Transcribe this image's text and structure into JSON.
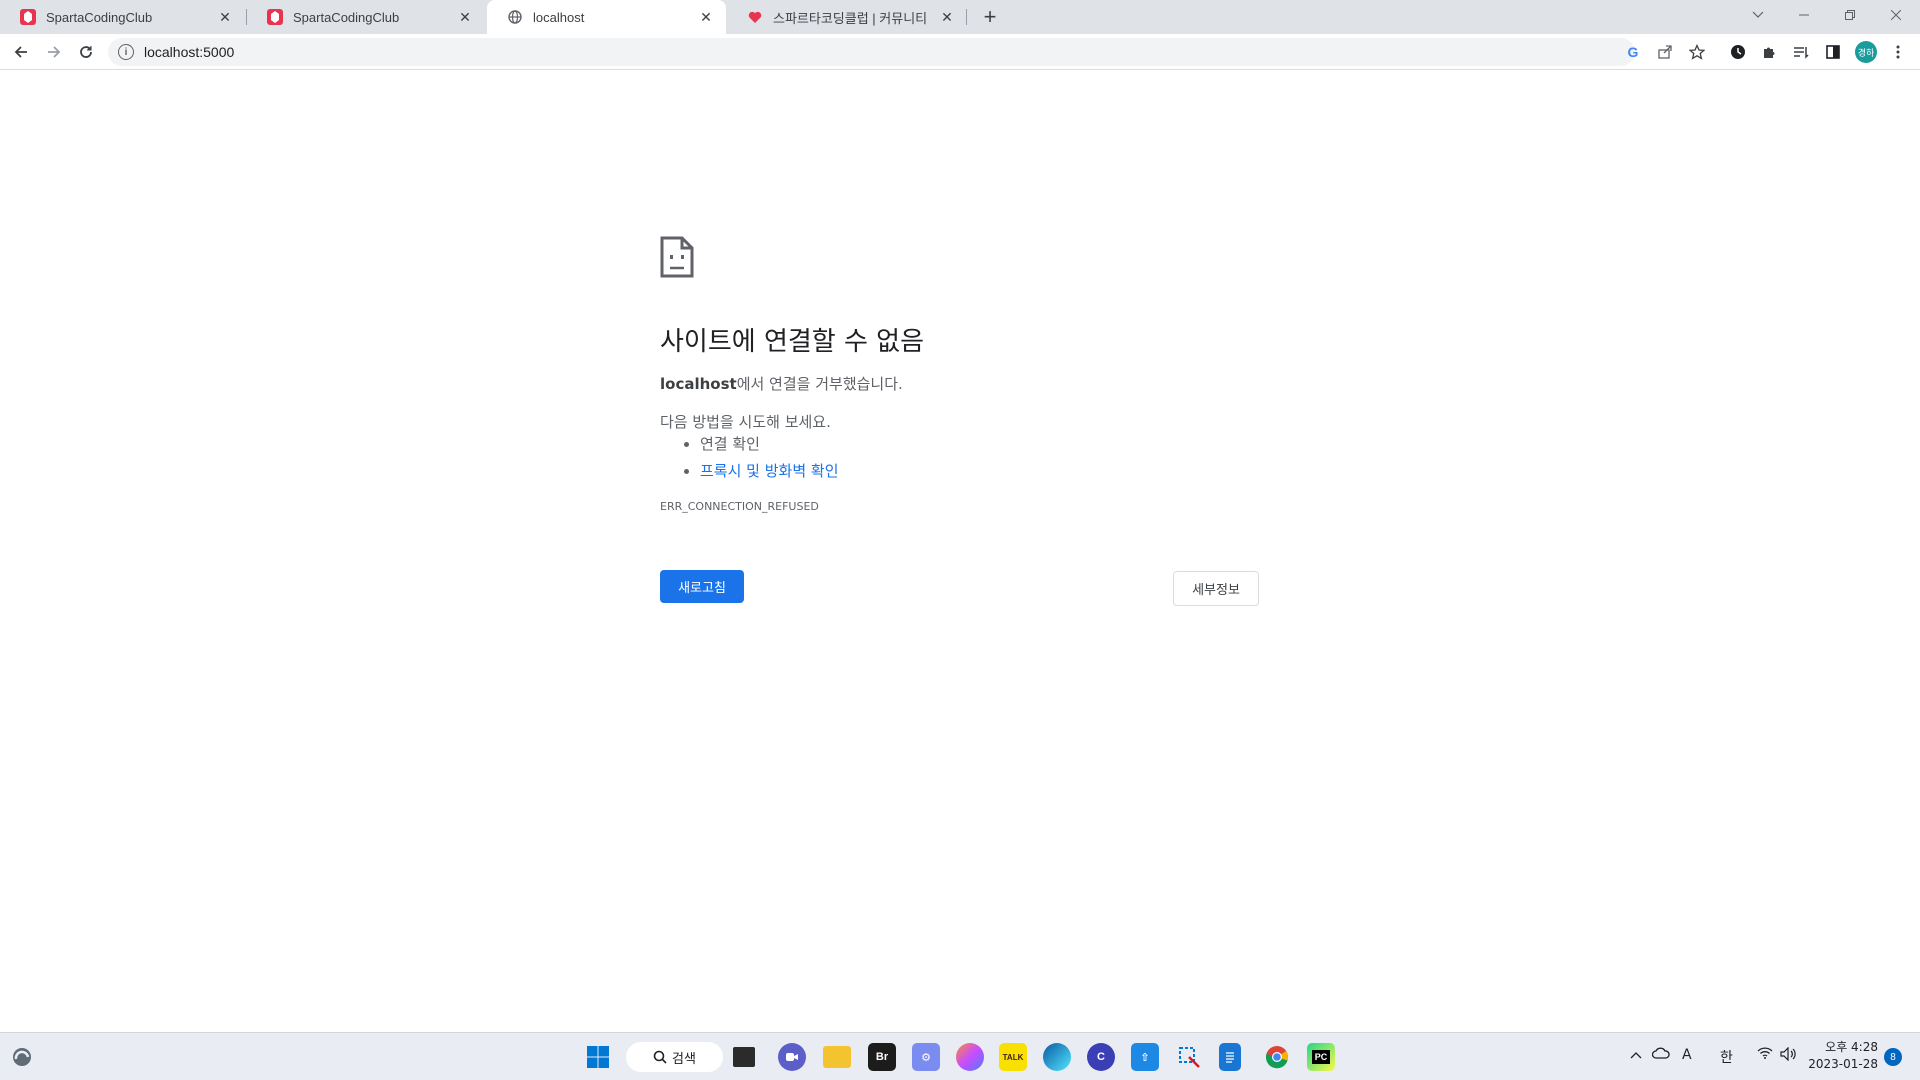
{
  "browser": {
    "tabs": [
      {
        "title": "SpartaCodingClub",
        "favicon": "sparta-icon",
        "active": false
      },
      {
        "title": "SpartaCodingClub",
        "favicon": "sparta-icon",
        "active": false
      },
      {
        "title": "localhost",
        "favicon": "globe-icon",
        "active": true
      },
      {
        "title": "스파르타코딩클럽 | 커뮤니티",
        "favicon": "heart-icon",
        "active": false
      }
    ],
    "url": "localhost:5000",
    "profile_initials": "경하"
  },
  "error_page": {
    "title": "사이트에 연결할 수 없음",
    "host": "localhost",
    "desc_suffix": "에서 연결을 거부했습니다.",
    "try_label": "다음 방법을 시도해 보세요.",
    "suggestions": [
      "연결 확인",
      "프록시 및 방화벽 확인"
    ],
    "error_code": "ERR_CONNECTION_REFUSED",
    "reload_label": "새로고침",
    "details_label": "세부정보"
  },
  "taskbar": {
    "search_label": "검색",
    "tray_ime": "한",
    "tray_font": "A",
    "time": "오후 4:28",
    "date": "2023-01-28",
    "notification_count": "8"
  },
  "colors": {
    "accent": "#1a73e8",
    "tabstrip": "#dfe3e8",
    "taskbar": "#e9edf3"
  }
}
